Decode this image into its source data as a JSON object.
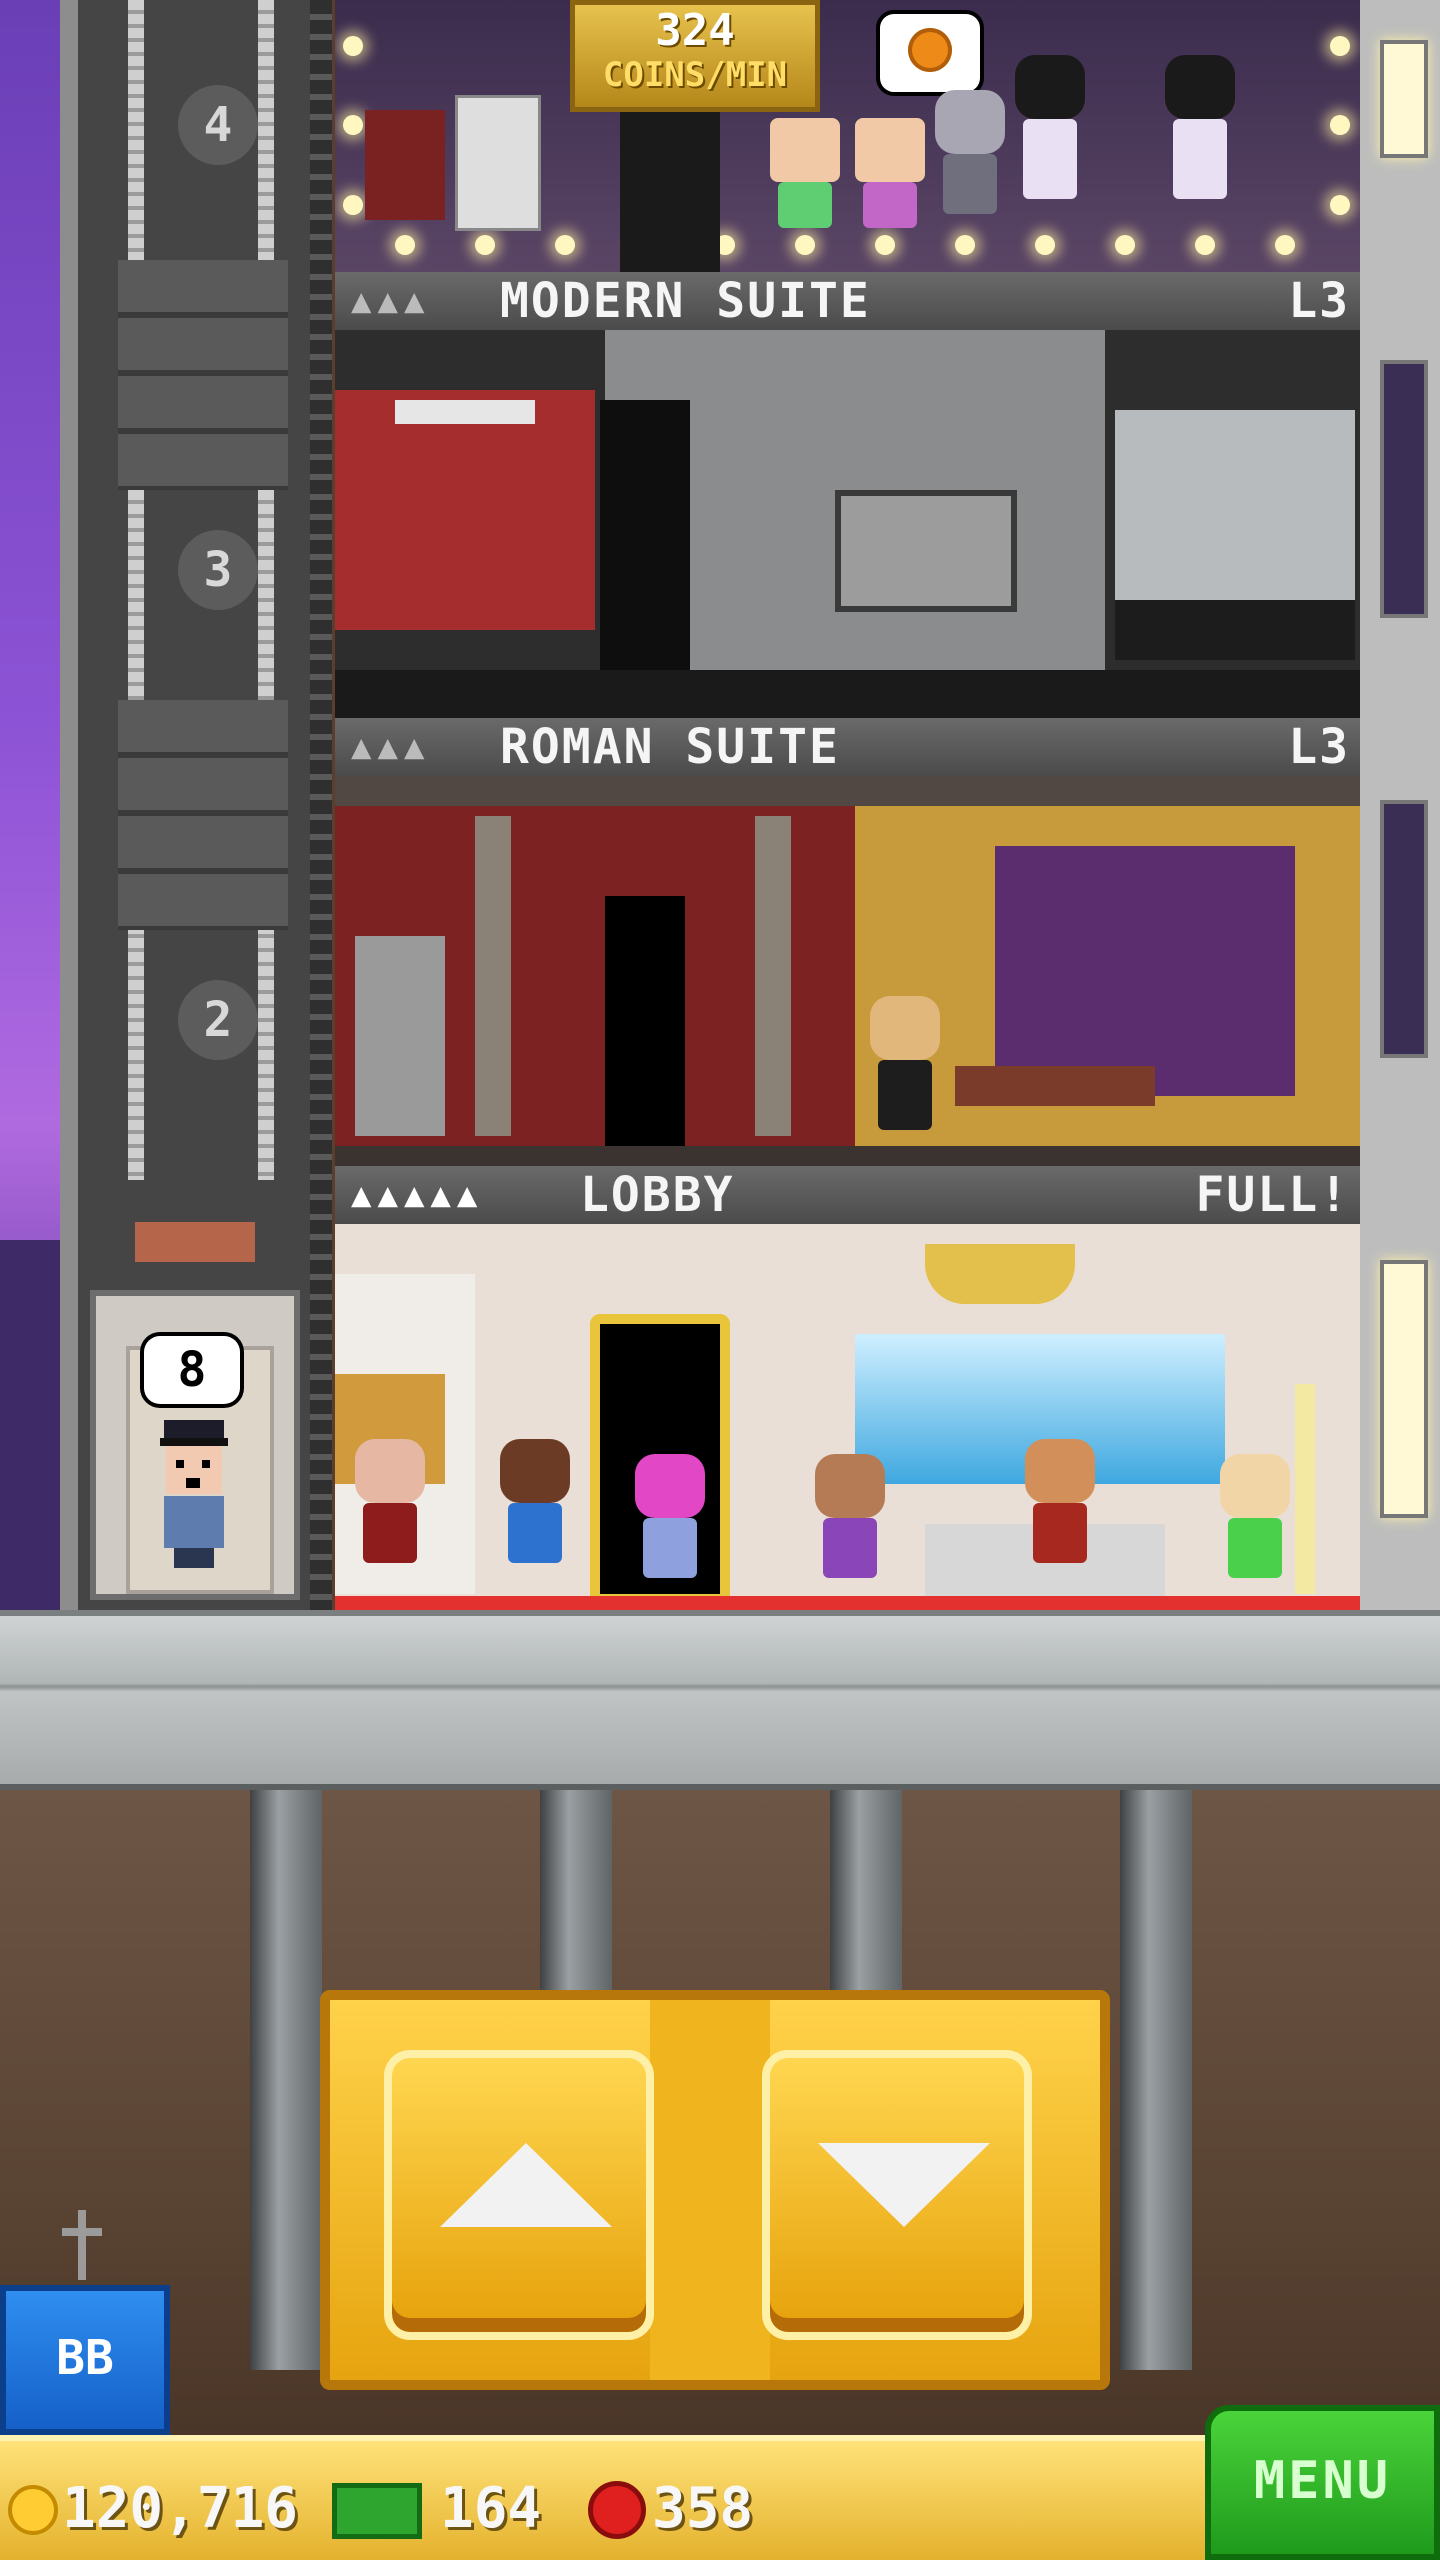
{
  "top_floor": {
    "coins_per_min_value": "324",
    "coins_per_min_unit": "COINS/MIN",
    "bubble_icon": "pumpkin-icon"
  },
  "floors": [
    {
      "name": "MODERN SUITE",
      "level": "L3",
      "occupancy_icon": "people-icon"
    },
    {
      "name": "ROMAN SUITE",
      "level": "L3",
      "occupancy_icon": "people-icon"
    },
    {
      "name": "LOBBY",
      "level": "FULL!",
      "occupancy_icon": "people-icon"
    }
  ],
  "elevator": {
    "floor_numbers": [
      "4",
      "3",
      "2"
    ],
    "passenger_count": "8"
  },
  "controls": {
    "up_icon": "arrow-up-icon",
    "down_icon": "arrow-down-icon"
  },
  "bb_button_label": "BB",
  "resources": {
    "coins": "120,716",
    "tower_bux": "164",
    "gems": "358"
  },
  "menu_label": "MENU",
  "colors": {
    "label_bar": "#555555",
    "gold": "#e6a40f",
    "menu_green": "#2fb52a",
    "bb_blue": "#1f72dc"
  }
}
